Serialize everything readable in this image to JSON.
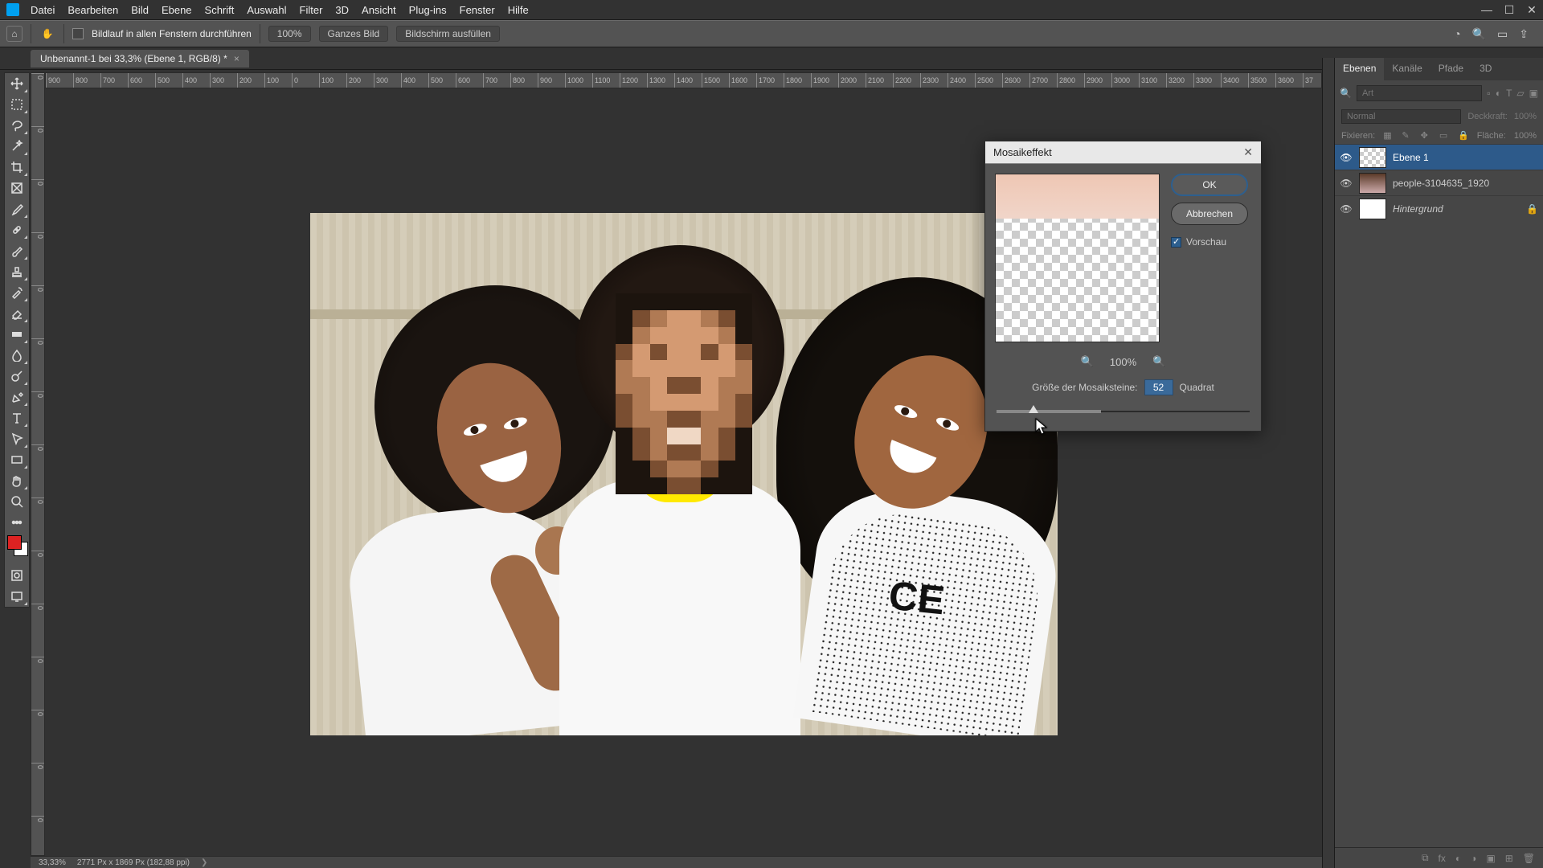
{
  "app": {
    "logo": "Ps"
  },
  "menu": [
    "Datei",
    "Bearbeiten",
    "Bild",
    "Ebene",
    "Schrift",
    "Auswahl",
    "Filter",
    "3D",
    "Ansicht",
    "Plug-ins",
    "Fenster",
    "Hilfe"
  ],
  "window_controls": {
    "min": "—",
    "max": "☐",
    "close": "✕"
  },
  "options_bar": {
    "scroll_all_label": "Bildlauf in allen Fenstern durchführen",
    "zoom_pct": "100%",
    "fit_btn": "Ganzes Bild",
    "fill_btn": "Bildschirm ausfüllen"
  },
  "document_tab": {
    "title": "Unbenannt-1 bei 33,3% (Ebene 1, RGB/8) *"
  },
  "ruler_h": [
    "900",
    "800",
    "700",
    "600",
    "500",
    "400",
    "300",
    "200",
    "100",
    "0",
    "100",
    "200",
    "300",
    "400",
    "500",
    "600",
    "700",
    "800",
    "900",
    "1000",
    "1100",
    "1200",
    "1300",
    "1400",
    "1500",
    "1600",
    "1700",
    "1800",
    "1900",
    "2000",
    "2100",
    "2200",
    "2300",
    "2400",
    "2500",
    "2600",
    "2700",
    "2800",
    "2900",
    "3000",
    "3100",
    "3200",
    "3300",
    "3400",
    "3500",
    "3600",
    "37"
  ],
  "ruler_v": [
    "0",
    "0",
    "0",
    "0",
    "0",
    "0",
    "0",
    "0",
    "0",
    "0",
    "0",
    "0",
    "0",
    "0",
    "0"
  ],
  "dialog": {
    "title": "Mosaikeffekt",
    "ok": "OK",
    "cancel": "Abbrechen",
    "preview_label": "Vorschau",
    "zoom_pct": "100%",
    "param_label": "Größe der Mosaiksteine:",
    "param_value": "52",
    "param_unit": "Quadrat"
  },
  "layers_panel": {
    "tabs": [
      "Ebenen",
      "Kanäle",
      "Pfade",
      "3D"
    ],
    "search_placeholder": "Art",
    "blend_mode": "Normal",
    "opacity_label": "Deckkraft:",
    "opacity_value": "100%",
    "lock_label": "Fixieren:",
    "fill_label": "Fläche:",
    "fill_value": "100%",
    "layers": [
      {
        "name": "Ebene 1",
        "selected": true,
        "thumb": "check"
      },
      {
        "name": "people-3104635_1920",
        "selected": false,
        "thumb": "photo"
      },
      {
        "name": "Hintergrund",
        "selected": false,
        "thumb": "white",
        "locked": true
      }
    ]
  },
  "status_bar": {
    "zoom": "33,33%",
    "info": "2771 Px x 1869 Px (182,88 ppi)"
  },
  "tools": [
    "move",
    "rect-marquee",
    "lasso",
    "magic-wand",
    "crop",
    "frame",
    "eyedropper",
    "heal",
    "brush",
    "stamp",
    "history-brush",
    "eraser",
    "gradient",
    "blur",
    "dodge",
    "pen",
    "type",
    "path-select",
    "rectangle",
    "hand",
    "zoom"
  ]
}
